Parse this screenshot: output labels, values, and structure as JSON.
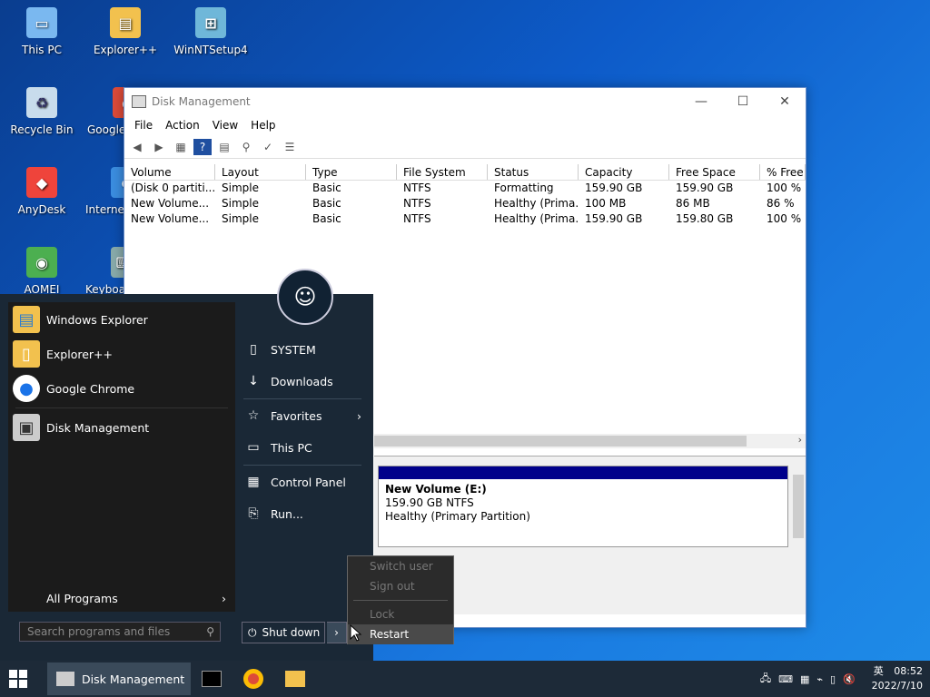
{
  "desktop_icons": [
    {
      "label": "This PC",
      "icon": "computer-icon"
    },
    {
      "label": "Explorer++",
      "icon": "folder-icon"
    },
    {
      "label": "WinNTSetup4",
      "icon": "setup-icon"
    },
    {
      "label": "Recycle Bin",
      "icon": "recycle-bin-icon"
    },
    {
      "label": "Google",
      "icon": "chrome-icon"
    },
    {
      "label": "AnyDesk",
      "icon": "anydesk-icon"
    },
    {
      "label": "Internet",
      "icon": "ie-icon"
    },
    {
      "label": "AOMEI Partition",
      "icon": "aomei-icon"
    },
    {
      "label": "Keyboa",
      "icon": "keyboard-icon"
    }
  ],
  "window": {
    "title": "Disk Management",
    "menu": [
      "File",
      "Action",
      "View",
      "Help"
    ],
    "columns": [
      "Volume",
      "Layout",
      "Type",
      "File System",
      "Status",
      "Capacity",
      "Free Space",
      "% Free"
    ],
    "rows": [
      [
        "(Disk 0 partiti...",
        "Simple",
        "Basic",
        "NTFS",
        "Formatting",
        "159.90 GB",
        "159.90 GB",
        "100 %"
      ],
      [
        "New Volume...",
        "Simple",
        "Basic",
        "NTFS",
        "Healthy (Prima...",
        "100 MB",
        "86 MB",
        "86 %"
      ],
      [
        "New Volume...",
        "Simple",
        "Basic",
        "NTFS",
        "Healthy (Prima...",
        "159.90 GB",
        "159.80 GB",
        "100 %"
      ]
    ],
    "volume_detail": {
      "name": "New Volume  (E:)",
      "size": "159.90 GB NTFS",
      "status": "Healthy (Primary Partition)"
    }
  },
  "start_menu": {
    "programs": [
      "Windows Explorer",
      "Explorer++",
      "Google Chrome",
      "Disk Management"
    ],
    "all_programs": "All Programs",
    "search_placeholder": "Search programs and files",
    "right_items": [
      "SYSTEM",
      "Downloads",
      "Favorites",
      "This PC",
      "Control Panel",
      "Run..."
    ],
    "shutdown_label": "Shut down"
  },
  "power_menu": {
    "items": [
      "Switch user",
      "Sign out",
      "Lock",
      "Restart"
    ]
  },
  "taskbar": {
    "active_app": "Disk Management",
    "time": "08:52",
    "date": "2022/7/10",
    "lang": "英"
  }
}
